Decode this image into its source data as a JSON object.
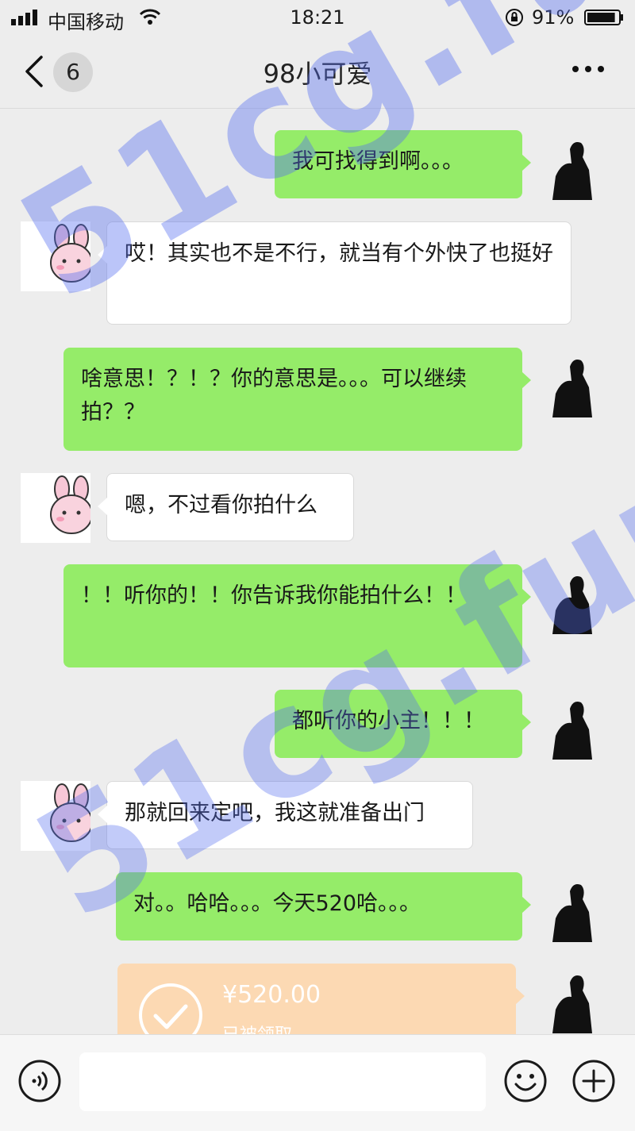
{
  "status_bar": {
    "carrier": "中国移动",
    "time": "18:21",
    "battery_percent": "91%",
    "battery_level": 0.91
  },
  "nav": {
    "unread_count": "6",
    "title": "98小可爱"
  },
  "messages": [
    {
      "side": "right",
      "text": "我可找得到啊。。。"
    },
    {
      "side": "left",
      "text": "哎！其实也不是不行，就当有个外快了也挺好"
    },
    {
      "side": "right",
      "text": "啥意思！？！？你的意思是。。。可以继续拍？？"
    },
    {
      "side": "left",
      "text": "嗯，不过看你拍什么"
    },
    {
      "side": "right",
      "text": "！！听你的！！你告诉我你能拍什么！！"
    },
    {
      "side": "right",
      "text": "都听你的小主！！！"
    },
    {
      "side": "left",
      "text": "那就回来定吧，我这就准备出门"
    },
    {
      "side": "right",
      "text": "对。。哈哈。。。今天520哈。。。"
    }
  ],
  "transfer": {
    "amount": "¥520.00",
    "status": "已被领取"
  },
  "watermark": {
    "text": "51cg.fun",
    "color": "#546ef0"
  },
  "colors": {
    "sent_bubble": "#95ec69",
    "received_bubble": "#ffffff",
    "background": "#ededed",
    "transfer": "#fcd9b3"
  }
}
